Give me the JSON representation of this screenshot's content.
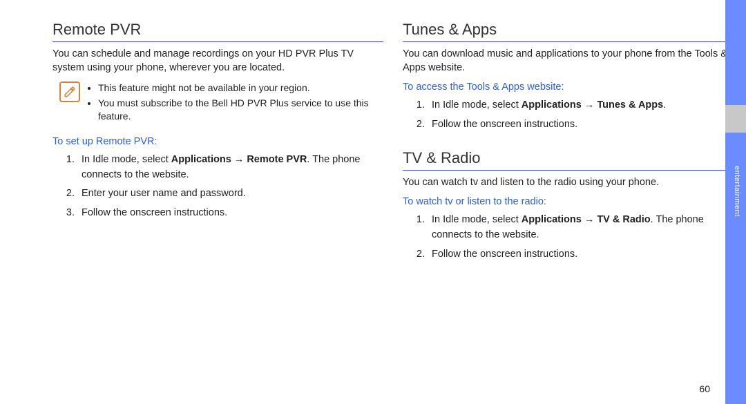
{
  "sidebar": {
    "label": "entertainment"
  },
  "pageNumber": "60",
  "left": {
    "heading1": "Remote PVR",
    "para1": "You can schedule and manage recordings on your HD PVR Plus TV system using your phone, wherever you are located.",
    "notes": {
      "b1": "This feature might not be available in your region.",
      "b2": "You must subscribe to the Bell HD PVR Plus service to use this feature."
    },
    "sub1": "To set up Remote PVR:",
    "step1_lead": "In Idle mode, select ",
    "step1_bold": "Applications → Remote PVR",
    "step1_tail": ". The phone connects to the website.",
    "step2": "Enter your user name and password.",
    "step3": "Follow the onscreen instructions."
  },
  "right": {
    "heading1": "Tunes & Apps",
    "para1": "You can download music and applications to your phone from the Tools & Apps website.",
    "sub1": "To access the Tools & Apps website:",
    "tunes_step1_lead": "In Idle mode, select ",
    "tunes_step1_bold": "Applications → Tunes & Apps",
    "tunes_step1_tail": ".",
    "tunes_step2": "Follow the onscreen instructions.",
    "heading2": "TV & Radio",
    "para2": "You can watch tv and listen to the radio using your phone.",
    "sub2": "To watch tv or listen to the radio:",
    "tv_step1_lead": "In Idle mode, select ",
    "tv_step1_bold": "Applications → TV & Radio",
    "tv_step1_tail": ". The phone connects to the website.",
    "tv_step2": "Follow the onscreen instructions."
  }
}
